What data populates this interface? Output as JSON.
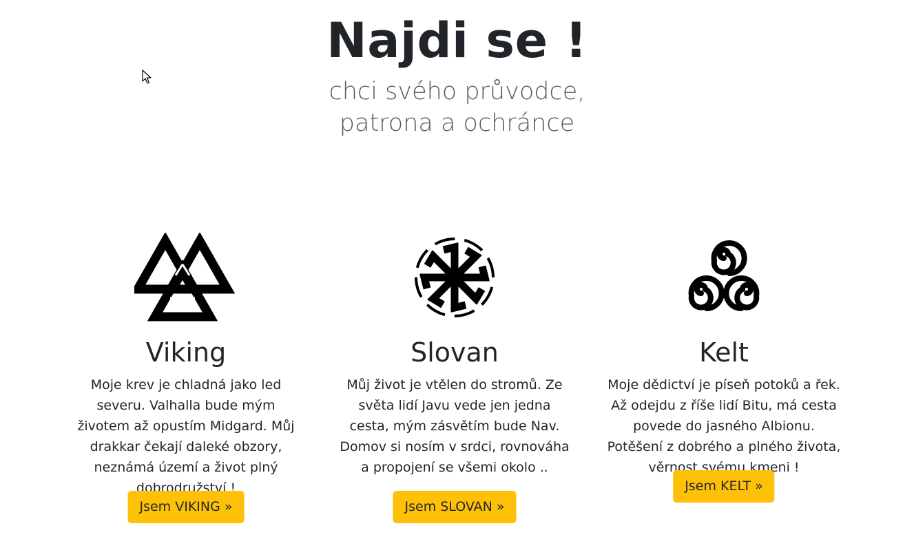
{
  "hero": {
    "title": "Najdi se !",
    "lead_line1": "chci svého průvodce,",
    "lead_line2": "patrona a ochránce"
  },
  "columns": [
    {
      "icon": "valknut-icon",
      "title": "Viking",
      "text": "Moje krev je chladná jako led severu. Valhalla bude mým životem až opustím Midgard. Můj drakkar čekají daleké obzory, neznámá území a život plný dobrodružství !",
      "button": "Jsem VIKING »"
    },
    {
      "icon": "kolovrat-icon",
      "title": "Slovan",
      "text": "Můj život je vtělen do stromů. Ze světa lidí Javu vede jen jedna cesta, mým zásvětím bude Nav. Domov si nosím v srdci, rovnováha a propojení se všemi okolo ..",
      "button": "Jsem SLOVAN »"
    },
    {
      "icon": "triskele-icon",
      "title": "Kelt",
      "text": "Moje dědictví je píseň potoků a řek. Až odejdu z říše lidí Bitu, má cesta povede do jasného Albionu. Potěšení z dobrého a plného života, věrnost svému kmeni !",
      "button": "Jsem KELT »"
    }
  ],
  "colors": {
    "button": "#ffc107",
    "text": "#212529",
    "lead": "#555a60"
  }
}
